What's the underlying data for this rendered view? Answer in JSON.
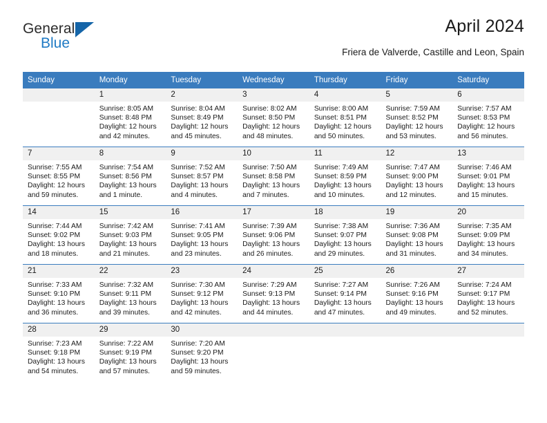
{
  "brand": {
    "name_part1": "General",
    "name_part2": "Blue",
    "accent_color": "#1f7ac4",
    "triangle_color": "#1565a8",
    "triangle_icon": "triangle-icon"
  },
  "header": {
    "title": "April 2024",
    "subtitle": "Friera de Valverde, Castille and Leon, Spain"
  },
  "calendar": {
    "header_bg": "#3a7cbe",
    "daynum_bg": "#f0f0f0",
    "weekday_headers": [
      "Sunday",
      "Monday",
      "Tuesday",
      "Wednesday",
      "Thursday",
      "Friday",
      "Saturday"
    ],
    "weeks": [
      [
        {
          "day": "",
          "sunrise": "",
          "sunset": "",
          "daylight1": "",
          "daylight2": ""
        },
        {
          "day": "1",
          "sunrise": "Sunrise: 8:05 AM",
          "sunset": "Sunset: 8:48 PM",
          "daylight1": "Daylight: 12 hours",
          "daylight2": "and 42 minutes."
        },
        {
          "day": "2",
          "sunrise": "Sunrise: 8:04 AM",
          "sunset": "Sunset: 8:49 PM",
          "daylight1": "Daylight: 12 hours",
          "daylight2": "and 45 minutes."
        },
        {
          "day": "3",
          "sunrise": "Sunrise: 8:02 AM",
          "sunset": "Sunset: 8:50 PM",
          "daylight1": "Daylight: 12 hours",
          "daylight2": "and 48 minutes."
        },
        {
          "day": "4",
          "sunrise": "Sunrise: 8:00 AM",
          "sunset": "Sunset: 8:51 PM",
          "daylight1": "Daylight: 12 hours",
          "daylight2": "and 50 minutes."
        },
        {
          "day": "5",
          "sunrise": "Sunrise: 7:59 AM",
          "sunset": "Sunset: 8:52 PM",
          "daylight1": "Daylight: 12 hours",
          "daylight2": "and 53 minutes."
        },
        {
          "day": "6",
          "sunrise": "Sunrise: 7:57 AM",
          "sunset": "Sunset: 8:53 PM",
          "daylight1": "Daylight: 12 hours",
          "daylight2": "and 56 minutes."
        }
      ],
      [
        {
          "day": "7",
          "sunrise": "Sunrise: 7:55 AM",
          "sunset": "Sunset: 8:55 PM",
          "daylight1": "Daylight: 12 hours",
          "daylight2": "and 59 minutes."
        },
        {
          "day": "8",
          "sunrise": "Sunrise: 7:54 AM",
          "sunset": "Sunset: 8:56 PM",
          "daylight1": "Daylight: 13 hours",
          "daylight2": "and 1 minute."
        },
        {
          "day": "9",
          "sunrise": "Sunrise: 7:52 AM",
          "sunset": "Sunset: 8:57 PM",
          "daylight1": "Daylight: 13 hours",
          "daylight2": "and 4 minutes."
        },
        {
          "day": "10",
          "sunrise": "Sunrise: 7:50 AM",
          "sunset": "Sunset: 8:58 PM",
          "daylight1": "Daylight: 13 hours",
          "daylight2": "and 7 minutes."
        },
        {
          "day": "11",
          "sunrise": "Sunrise: 7:49 AM",
          "sunset": "Sunset: 8:59 PM",
          "daylight1": "Daylight: 13 hours",
          "daylight2": "and 10 minutes."
        },
        {
          "day": "12",
          "sunrise": "Sunrise: 7:47 AM",
          "sunset": "Sunset: 9:00 PM",
          "daylight1": "Daylight: 13 hours",
          "daylight2": "and 12 minutes."
        },
        {
          "day": "13",
          "sunrise": "Sunrise: 7:46 AM",
          "sunset": "Sunset: 9:01 PM",
          "daylight1": "Daylight: 13 hours",
          "daylight2": "and 15 minutes."
        }
      ],
      [
        {
          "day": "14",
          "sunrise": "Sunrise: 7:44 AM",
          "sunset": "Sunset: 9:02 PM",
          "daylight1": "Daylight: 13 hours",
          "daylight2": "and 18 minutes."
        },
        {
          "day": "15",
          "sunrise": "Sunrise: 7:42 AM",
          "sunset": "Sunset: 9:03 PM",
          "daylight1": "Daylight: 13 hours",
          "daylight2": "and 21 minutes."
        },
        {
          "day": "16",
          "sunrise": "Sunrise: 7:41 AM",
          "sunset": "Sunset: 9:05 PM",
          "daylight1": "Daylight: 13 hours",
          "daylight2": "and 23 minutes."
        },
        {
          "day": "17",
          "sunrise": "Sunrise: 7:39 AM",
          "sunset": "Sunset: 9:06 PM",
          "daylight1": "Daylight: 13 hours",
          "daylight2": "and 26 minutes."
        },
        {
          "day": "18",
          "sunrise": "Sunrise: 7:38 AM",
          "sunset": "Sunset: 9:07 PM",
          "daylight1": "Daylight: 13 hours",
          "daylight2": "and 29 minutes."
        },
        {
          "day": "19",
          "sunrise": "Sunrise: 7:36 AM",
          "sunset": "Sunset: 9:08 PM",
          "daylight1": "Daylight: 13 hours",
          "daylight2": "and 31 minutes."
        },
        {
          "day": "20",
          "sunrise": "Sunrise: 7:35 AM",
          "sunset": "Sunset: 9:09 PM",
          "daylight1": "Daylight: 13 hours",
          "daylight2": "and 34 minutes."
        }
      ],
      [
        {
          "day": "21",
          "sunrise": "Sunrise: 7:33 AM",
          "sunset": "Sunset: 9:10 PM",
          "daylight1": "Daylight: 13 hours",
          "daylight2": "and 36 minutes."
        },
        {
          "day": "22",
          "sunrise": "Sunrise: 7:32 AM",
          "sunset": "Sunset: 9:11 PM",
          "daylight1": "Daylight: 13 hours",
          "daylight2": "and 39 minutes."
        },
        {
          "day": "23",
          "sunrise": "Sunrise: 7:30 AM",
          "sunset": "Sunset: 9:12 PM",
          "daylight1": "Daylight: 13 hours",
          "daylight2": "and 42 minutes."
        },
        {
          "day": "24",
          "sunrise": "Sunrise: 7:29 AM",
          "sunset": "Sunset: 9:13 PM",
          "daylight1": "Daylight: 13 hours",
          "daylight2": "and 44 minutes."
        },
        {
          "day": "25",
          "sunrise": "Sunrise: 7:27 AM",
          "sunset": "Sunset: 9:14 PM",
          "daylight1": "Daylight: 13 hours",
          "daylight2": "and 47 minutes."
        },
        {
          "day": "26",
          "sunrise": "Sunrise: 7:26 AM",
          "sunset": "Sunset: 9:16 PM",
          "daylight1": "Daylight: 13 hours",
          "daylight2": "and 49 minutes."
        },
        {
          "day": "27",
          "sunrise": "Sunrise: 7:24 AM",
          "sunset": "Sunset: 9:17 PM",
          "daylight1": "Daylight: 13 hours",
          "daylight2": "and 52 minutes."
        }
      ],
      [
        {
          "day": "28",
          "sunrise": "Sunrise: 7:23 AM",
          "sunset": "Sunset: 9:18 PM",
          "daylight1": "Daylight: 13 hours",
          "daylight2": "and 54 minutes."
        },
        {
          "day": "29",
          "sunrise": "Sunrise: 7:22 AM",
          "sunset": "Sunset: 9:19 PM",
          "daylight1": "Daylight: 13 hours",
          "daylight2": "and 57 minutes."
        },
        {
          "day": "30",
          "sunrise": "Sunrise: 7:20 AM",
          "sunset": "Sunset: 9:20 PM",
          "daylight1": "Daylight: 13 hours",
          "daylight2": "and 59 minutes."
        },
        {
          "day": "",
          "sunrise": "",
          "sunset": "",
          "daylight1": "",
          "daylight2": ""
        },
        {
          "day": "",
          "sunrise": "",
          "sunset": "",
          "daylight1": "",
          "daylight2": ""
        },
        {
          "day": "",
          "sunrise": "",
          "sunset": "",
          "daylight1": "",
          "daylight2": ""
        },
        {
          "day": "",
          "sunrise": "",
          "sunset": "",
          "daylight1": "",
          "daylight2": ""
        }
      ]
    ]
  }
}
